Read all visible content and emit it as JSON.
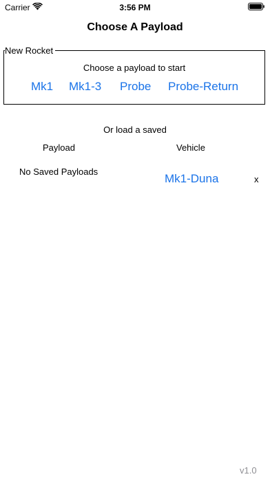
{
  "status_bar": {
    "carrier": "Carrier",
    "time": "3:56 PM",
    "wifi_icon": "wifi-icon",
    "battery_icon": "battery-icon"
  },
  "title": "Choose A Payload",
  "new_rocket": {
    "legend": "New Rocket",
    "prompt": "Choose a payload to start",
    "payloads": [
      "Mk1",
      "Mk1-3",
      "Probe",
      "Probe-Return"
    ]
  },
  "saved": {
    "heading": "Or load a saved",
    "column_payload": "Payload",
    "column_vehicle": "Vehicle",
    "payload_empty": "No Saved Payloads",
    "vehicles": [
      {
        "name": "Mk1-Duna",
        "delete_label": "x"
      }
    ]
  },
  "footer": {
    "version": "v1.0"
  },
  "colors": {
    "link": "#1a73e8",
    "text": "#000000",
    "muted": "#8e8e93"
  }
}
